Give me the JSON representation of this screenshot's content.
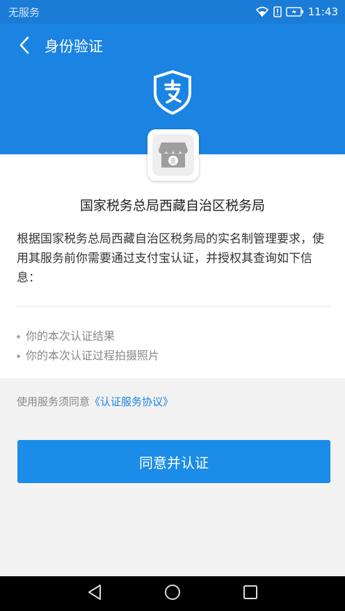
{
  "status_bar": {
    "carrier": "无服务",
    "time": "11:43"
  },
  "header": {
    "title": "身份验证",
    "back_icon": "chevron-left-icon",
    "logo_icon": "alipay-shield-icon",
    "colors": {
      "background": "#1b84e3"
    }
  },
  "app": {
    "icon": "storefront-icon",
    "name": "国家税务总局西藏自治区税务局"
  },
  "description": "根据国家税务总局西藏自治区税务局的实名制管理要求，使用其服务前你需要通过支付宝认证，并授权其查询如下信息：",
  "info_items": [
    "你的本次认证结果",
    "你的本次认证过程拍摄照片"
  ],
  "agreement": {
    "prefix": "使用服务须同意",
    "link": "《认证服务协议》"
  },
  "primary_button": {
    "label": "同意并认证",
    "color": "#1b8ce8"
  },
  "nav_bar": {
    "back": "triangle-back-icon",
    "home": "circle-home-icon",
    "recents": "square-recents-icon"
  }
}
